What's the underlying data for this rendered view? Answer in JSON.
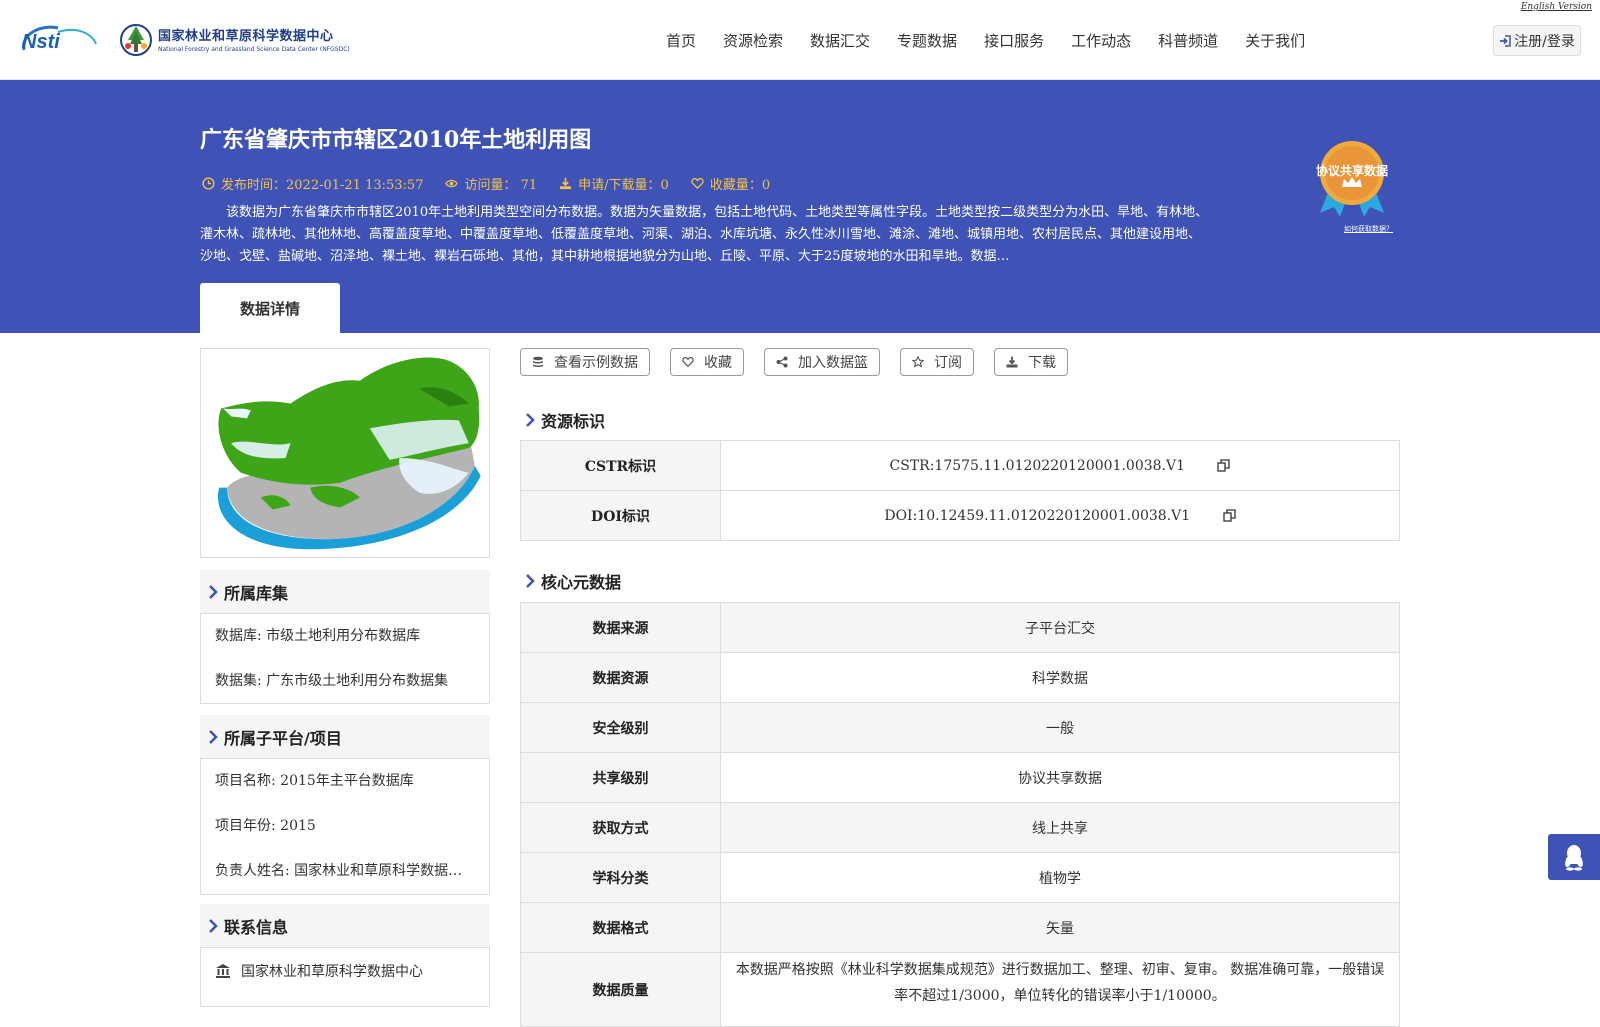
{
  "header": {
    "english_version": "English Version",
    "center_name_cn": "国家林业和草原科学数据中心",
    "center_name_en": "National Forestry and Grassland Science Data Center (NFGSDC)",
    "nav": [
      "首页",
      "资源检索",
      "数据汇交",
      "专题数据",
      "接口服务",
      "工作动态",
      "科普频道",
      "关于我们"
    ],
    "login_label": "注册/登录"
  },
  "banner": {
    "title": "广东省肇庆市市辖区2010年土地利用图",
    "publish_time": "发布时间：2022-01-21 13:53:57",
    "visits": "访问量： 71",
    "downloads": "申请/下载量：0",
    "favorites": "收藏量：0",
    "description": "该数据为广东省肇庆市市辖区2010年土地利用类型空间分布数据。数据为矢量数据，包括土地代码、土地类型等属性字段。土地类型按二级类型分为水田、旱地、有林地、灌木林、疏林地、其他林地、高覆盖度草地、中覆盖度草地、低覆盖度草地、河渠、湖泊、水库坑塘、永久性冰川雪地、滩涂、滩地、城镇用地、农村居民点、其他建设用地、沙地、戈壁、盐碱地、沼泽地、裸土地、裸岩石砾地、其他，其中耕地根据地貌分为山地、丘陵、平原、大于25度坡地的水田和旱地。数据…",
    "badge_text": "协议共享数据",
    "badge_link": "如何获取数据？",
    "tab": "数据详情"
  },
  "sidebar": {
    "collection_title": "所属库集",
    "collection_lines": [
      "数据库: 市级土地利用分布数据库",
      "数据集: 广东市级土地利用分布数据集"
    ],
    "project_title": "所属子平台/项目",
    "project_lines": [
      "项目名称: 2015年主平台数据库",
      "项目年份: 2015",
      "负责人姓名: 国家林业和草原科学数据中心"
    ],
    "contact_title": "联系信息",
    "contact_org": "国家林业和草原科学数据中心"
  },
  "actions": [
    "查看示例数据",
    "收藏",
    "加入数据篮",
    "订阅",
    "下载"
  ],
  "identity": {
    "title": "资源标识",
    "rows": [
      {
        "key": "CSTR标识",
        "value": "CSTR:17575.11.0120220120001.0038.V1"
      },
      {
        "key": "DOI标识",
        "value": "DOI:10.12459.11.0120220120001.0038.V1"
      }
    ]
  },
  "core": {
    "title": "核心元数据",
    "rows": [
      {
        "key": "数据来源",
        "value": "子平台汇交"
      },
      {
        "key": "数据资源",
        "value": "科学数据"
      },
      {
        "key": "安全级别",
        "value": "一般"
      },
      {
        "key": "共享级别",
        "value": "协议共享数据"
      },
      {
        "key": "获取方式",
        "value": "线上共享"
      },
      {
        "key": "学科分类",
        "value": "植物学"
      },
      {
        "key": "数据格式",
        "value": "矢量"
      },
      {
        "key": "数据质量",
        "value": "本数据严格按照《林业科学数据集成规范》进行数据加工、整理、初审、复审。 数据准确可靠，一般错误率不超过1/3000，单位转化的错误率小于1/10000。"
      }
    ]
  },
  "colors": {
    "banner": "#3e53b5",
    "meta_gold": "#f2c14e",
    "brand_blue": "#1f3f8a"
  }
}
